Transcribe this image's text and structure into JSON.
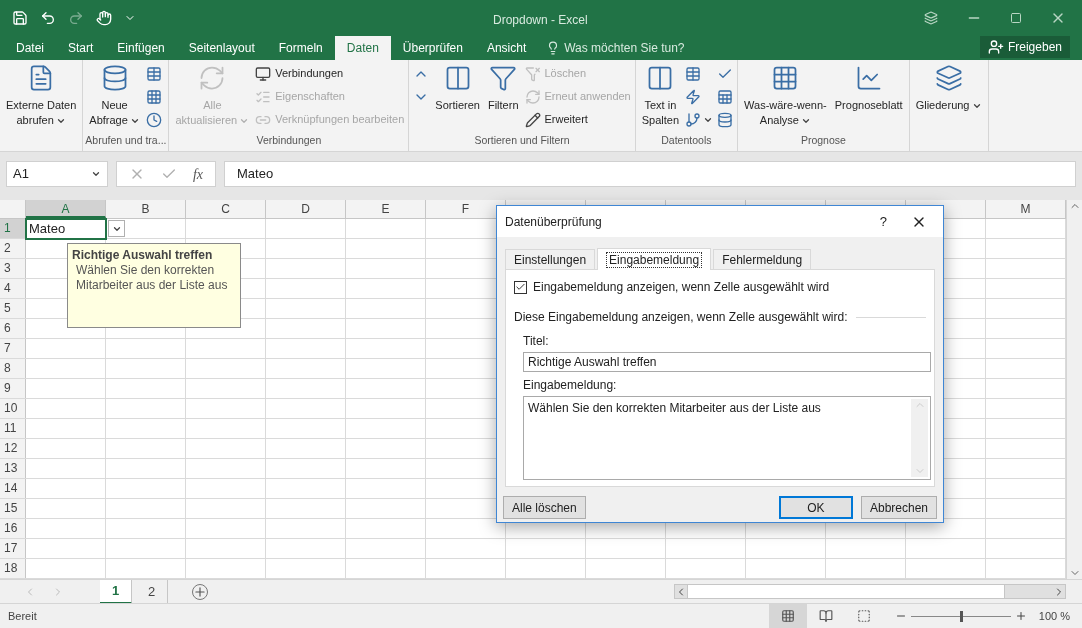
{
  "window": {
    "title": "Dropdown - Excel"
  },
  "ribbon_tabs": [
    {
      "label": "Datei",
      "selected": false
    },
    {
      "label": "Start",
      "selected": false
    },
    {
      "label": "Einfügen",
      "selected": false
    },
    {
      "label": "Seitenlayout",
      "selected": false
    },
    {
      "label": "Formeln",
      "selected": false
    },
    {
      "label": "Daten",
      "selected": true
    },
    {
      "label": "Überprüfen",
      "selected": false
    },
    {
      "label": "Ansicht",
      "selected": false
    }
  ],
  "tell_me": {
    "placeholder": "Was möchten Sie tun?"
  },
  "share_button": "Freigeben",
  "ribbon_groups": [
    {
      "items": [
        {
          "kind": "large",
          "lines": [
            "Externe Daten",
            "abrufen"
          ],
          "dropdown": true,
          "disabled": false
        }
      ]
    },
    {
      "label": "Abrufen und tra...",
      "items": [
        {
          "kind": "large",
          "lines": [
            "Neue",
            "Abfrage"
          ],
          "dropdown": true,
          "disabled": false
        },
        {
          "kind": "stack",
          "children": [
            {
              "kind": "icon"
            },
            {
              "kind": "icon"
            },
            {
              "kind": "icon"
            }
          ]
        }
      ]
    },
    {
      "label": "Verbindungen",
      "items": [
        {
          "kind": "large",
          "lines": [
            "Alle",
            "aktualisieren"
          ],
          "dropdown": true,
          "disabled": true
        },
        {
          "kind": "stack",
          "children": [
            {
              "label": "Verbindungen",
              "disabled": false
            },
            {
              "label": "Eigenschaften",
              "disabled": true
            },
            {
              "label": "Verknüpfungen bearbeiten",
              "disabled": true
            }
          ]
        }
      ]
    },
    {
      "label": "Sortieren und Filtern",
      "items": [
        {
          "kind": "stack",
          "children": [
            {
              "kind": "icon"
            },
            {
              "kind": "icon"
            }
          ]
        },
        {
          "kind": "large",
          "lines": [
            "Sortieren"
          ],
          "dropdown": false,
          "disabled": false
        },
        {
          "kind": "large",
          "lines": [
            "Filtern"
          ],
          "dropdown": false,
          "disabled": false
        },
        {
          "kind": "stack",
          "children": [
            {
              "label": "Löschen",
              "disabled": true
            },
            {
              "label": "Erneut anwenden",
              "disabled": true
            },
            {
              "label": "Erweitert",
              "disabled": false
            }
          ]
        }
      ]
    },
    {
      "label": "Datentools",
      "items": [
        {
          "kind": "large",
          "lines": [
            "Text in",
            "Spalten"
          ],
          "dropdown": false,
          "disabled": false
        },
        {
          "kind": "stack",
          "children": [
            {
              "kind": "icon"
            },
            {
              "kind": "icon"
            },
            {
              "kind": "icon",
              "dropdown": true
            }
          ]
        },
        {
          "kind": "stack",
          "children": [
            {
              "kind": "icon"
            },
            {
              "kind": "icon"
            },
            {
              "kind": "icon"
            }
          ]
        }
      ]
    },
    {
      "label": "Prognose",
      "items": [
        {
          "kind": "large",
          "lines": [
            "Was-wäre-wenn-",
            "Analyse"
          ],
          "dropdown": true,
          "disabled": false
        },
        {
          "kind": "large",
          "lines": [
            "Prognoseblatt"
          ],
          "dropdown": false,
          "disabled": false
        }
      ]
    },
    {
      "items": [
        {
          "kind": "large",
          "lines": [
            "Gliederung"
          ],
          "dropdown": true,
          "disabled": false
        }
      ]
    }
  ],
  "formula_bar": {
    "name_box": "A1",
    "function_label": "fx",
    "value": "Mateo"
  },
  "columns": [
    {
      "label": "A",
      "selected": true
    },
    {
      "label": "B",
      "selected": false
    },
    {
      "label": "C",
      "selected": false
    },
    {
      "label": "D",
      "selected": false
    },
    {
      "label": "E",
      "selected": false
    },
    {
      "label": "F",
      "selected": false
    },
    {
      "label": "M",
      "selected": false
    }
  ],
  "rows": [
    {
      "label": "1",
      "selected": true
    },
    {
      "label": "2",
      "selected": false
    },
    {
      "label": "3",
      "selected": false
    },
    {
      "label": "4",
      "selected": false
    },
    {
      "label": "5",
      "selected": false
    },
    {
      "label": "6",
      "selected": false
    },
    {
      "label": "7",
      "selected": false
    },
    {
      "label": "8",
      "selected": false
    },
    {
      "label": "9",
      "selected": false
    },
    {
      "label": "10",
      "selected": false
    },
    {
      "label": "11",
      "selected": false
    },
    {
      "label": "12",
      "selected": false
    },
    {
      "label": "13",
      "selected": false
    },
    {
      "label": "14",
      "selected": false
    },
    {
      "label": "15",
      "selected": false
    },
    {
      "label": "16",
      "selected": false
    },
    {
      "label": "17",
      "selected": false
    },
    {
      "label": "18",
      "selected": false
    }
  ],
  "active_cell": {
    "value": "Mateo"
  },
  "input_tooltip": {
    "title": "Richtige Auswahl treffen",
    "lines": [
      "Wählen Sie den korrekten",
      "Mitarbeiter aus der Liste aus"
    ]
  },
  "dialog": {
    "title": "Datenüberprüfung",
    "help": "?",
    "tabs": [
      {
        "label": "Einstellungen",
        "selected": false
      },
      {
        "label": "Eingabemeldung",
        "selected": true
      },
      {
        "label": "Fehlermeldung",
        "selected": false
      }
    ],
    "show_checkbox": {
      "label": "Eingabemeldung anzeigen, wenn Zelle ausgewählt wird",
      "checked": true
    },
    "section": "Diese Eingabemeldung anzeigen, wenn Zelle ausgewählt wird:",
    "title_field": {
      "label": "Titel:",
      "value": "Richtige Auswahl treffen"
    },
    "message_field": {
      "label": "Eingabemeldung:",
      "value": "Wählen Sie den korrekten Mitarbeiter aus der Liste aus"
    },
    "buttons": [
      {
        "label": "Alle löschen",
        "kind": "secondary"
      },
      {
        "label": "OK",
        "kind": "default"
      },
      {
        "label": "Abbrechen",
        "kind": "secondary"
      }
    ]
  },
  "sheet_tabs": [
    {
      "label": "1",
      "selected": true
    },
    {
      "label": "2",
      "selected": false
    }
  ],
  "status_bar": {
    "status": "Bereit",
    "views": [
      {
        "selected": true
      },
      {
        "selected": false
      },
      {
        "selected": false
      }
    ],
    "zoom": {
      "level": 0.5,
      "reading": "100 %"
    }
  }
}
